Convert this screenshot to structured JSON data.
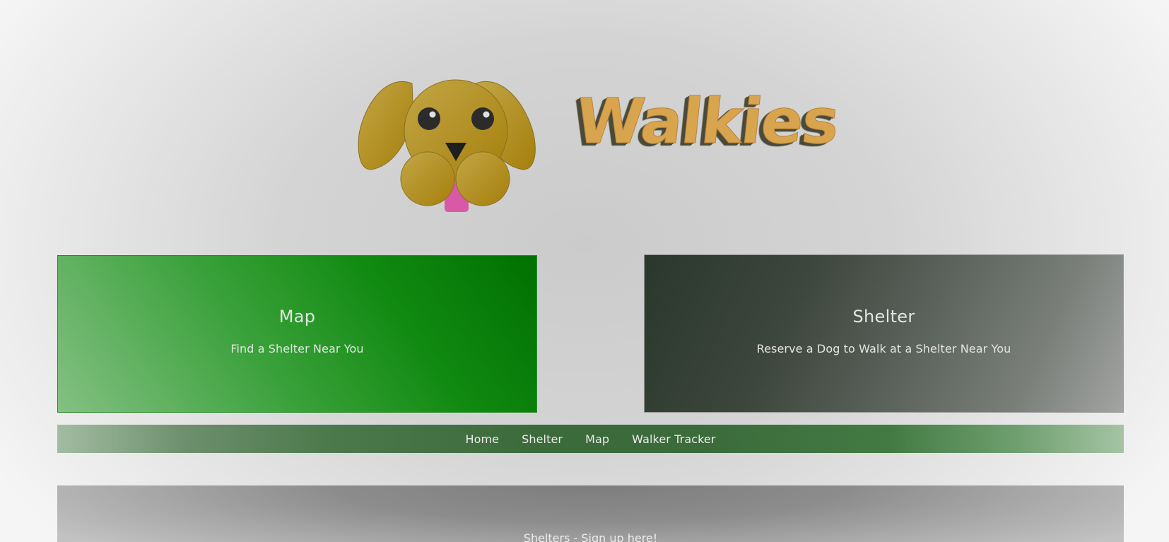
{
  "brand": {
    "name": "Walkies",
    "logo_icon": "dog-face-icon",
    "word_color": "#d9a44e"
  },
  "cards": {
    "map": {
      "title": "Map",
      "subtitle": "Find a Shelter Near You",
      "color": "#007000"
    },
    "shelter": {
      "title": "Shelter",
      "subtitle": "Reserve a Dog to Walk at a Shelter Near You",
      "color": "#2b372c"
    }
  },
  "nav": {
    "items": [
      {
        "label": "Home"
      },
      {
        "label": "Shelter"
      },
      {
        "label": "Map"
      },
      {
        "label": "Walker Tracker"
      }
    ],
    "color": "#3b6a3b"
  },
  "signup": {
    "text": "Shelters - Sign up here!"
  }
}
